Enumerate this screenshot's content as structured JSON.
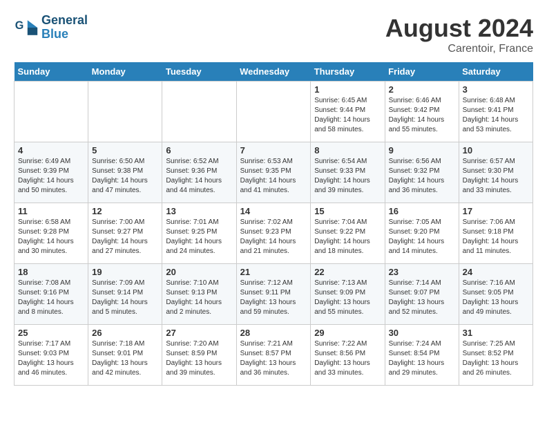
{
  "header": {
    "logo_line1": "General",
    "logo_line2": "Blue",
    "month_title": "August 2024",
    "location": "Carentoir, France"
  },
  "weekdays": [
    "Sunday",
    "Monday",
    "Tuesday",
    "Wednesday",
    "Thursday",
    "Friday",
    "Saturday"
  ],
  "weeks": [
    [
      {
        "day": "",
        "info": ""
      },
      {
        "day": "",
        "info": ""
      },
      {
        "day": "",
        "info": ""
      },
      {
        "day": "",
        "info": ""
      },
      {
        "day": "1",
        "info": "Sunrise: 6:45 AM\nSunset: 9:44 PM\nDaylight: 14 hours\nand 58 minutes."
      },
      {
        "day": "2",
        "info": "Sunrise: 6:46 AM\nSunset: 9:42 PM\nDaylight: 14 hours\nand 55 minutes."
      },
      {
        "day": "3",
        "info": "Sunrise: 6:48 AM\nSunset: 9:41 PM\nDaylight: 14 hours\nand 53 minutes."
      }
    ],
    [
      {
        "day": "4",
        "info": "Sunrise: 6:49 AM\nSunset: 9:39 PM\nDaylight: 14 hours\nand 50 minutes."
      },
      {
        "day": "5",
        "info": "Sunrise: 6:50 AM\nSunset: 9:38 PM\nDaylight: 14 hours\nand 47 minutes."
      },
      {
        "day": "6",
        "info": "Sunrise: 6:52 AM\nSunset: 9:36 PM\nDaylight: 14 hours\nand 44 minutes."
      },
      {
        "day": "7",
        "info": "Sunrise: 6:53 AM\nSunset: 9:35 PM\nDaylight: 14 hours\nand 41 minutes."
      },
      {
        "day": "8",
        "info": "Sunrise: 6:54 AM\nSunset: 9:33 PM\nDaylight: 14 hours\nand 39 minutes."
      },
      {
        "day": "9",
        "info": "Sunrise: 6:56 AM\nSunset: 9:32 PM\nDaylight: 14 hours\nand 36 minutes."
      },
      {
        "day": "10",
        "info": "Sunrise: 6:57 AM\nSunset: 9:30 PM\nDaylight: 14 hours\nand 33 minutes."
      }
    ],
    [
      {
        "day": "11",
        "info": "Sunrise: 6:58 AM\nSunset: 9:28 PM\nDaylight: 14 hours\nand 30 minutes."
      },
      {
        "day": "12",
        "info": "Sunrise: 7:00 AM\nSunset: 9:27 PM\nDaylight: 14 hours\nand 27 minutes."
      },
      {
        "day": "13",
        "info": "Sunrise: 7:01 AM\nSunset: 9:25 PM\nDaylight: 14 hours\nand 24 minutes."
      },
      {
        "day": "14",
        "info": "Sunrise: 7:02 AM\nSunset: 9:23 PM\nDaylight: 14 hours\nand 21 minutes."
      },
      {
        "day": "15",
        "info": "Sunrise: 7:04 AM\nSunset: 9:22 PM\nDaylight: 14 hours\nand 18 minutes."
      },
      {
        "day": "16",
        "info": "Sunrise: 7:05 AM\nSunset: 9:20 PM\nDaylight: 14 hours\nand 14 minutes."
      },
      {
        "day": "17",
        "info": "Sunrise: 7:06 AM\nSunset: 9:18 PM\nDaylight: 14 hours\nand 11 minutes."
      }
    ],
    [
      {
        "day": "18",
        "info": "Sunrise: 7:08 AM\nSunset: 9:16 PM\nDaylight: 14 hours\nand 8 minutes."
      },
      {
        "day": "19",
        "info": "Sunrise: 7:09 AM\nSunset: 9:14 PM\nDaylight: 14 hours\nand 5 minutes."
      },
      {
        "day": "20",
        "info": "Sunrise: 7:10 AM\nSunset: 9:13 PM\nDaylight: 14 hours\nand 2 minutes."
      },
      {
        "day": "21",
        "info": "Sunrise: 7:12 AM\nSunset: 9:11 PM\nDaylight: 13 hours\nand 59 minutes."
      },
      {
        "day": "22",
        "info": "Sunrise: 7:13 AM\nSunset: 9:09 PM\nDaylight: 13 hours\nand 55 minutes."
      },
      {
        "day": "23",
        "info": "Sunrise: 7:14 AM\nSunset: 9:07 PM\nDaylight: 13 hours\nand 52 minutes."
      },
      {
        "day": "24",
        "info": "Sunrise: 7:16 AM\nSunset: 9:05 PM\nDaylight: 13 hours\nand 49 minutes."
      }
    ],
    [
      {
        "day": "25",
        "info": "Sunrise: 7:17 AM\nSunset: 9:03 PM\nDaylight: 13 hours\nand 46 minutes."
      },
      {
        "day": "26",
        "info": "Sunrise: 7:18 AM\nSunset: 9:01 PM\nDaylight: 13 hours\nand 42 minutes."
      },
      {
        "day": "27",
        "info": "Sunrise: 7:20 AM\nSunset: 8:59 PM\nDaylight: 13 hours\nand 39 minutes."
      },
      {
        "day": "28",
        "info": "Sunrise: 7:21 AM\nSunset: 8:57 PM\nDaylight: 13 hours\nand 36 minutes."
      },
      {
        "day": "29",
        "info": "Sunrise: 7:22 AM\nSunset: 8:56 PM\nDaylight: 13 hours\nand 33 minutes."
      },
      {
        "day": "30",
        "info": "Sunrise: 7:24 AM\nSunset: 8:54 PM\nDaylight: 13 hours\nand 29 minutes."
      },
      {
        "day": "31",
        "info": "Sunrise: 7:25 AM\nSunset: 8:52 PM\nDaylight: 13 hours\nand 26 minutes."
      }
    ]
  ]
}
